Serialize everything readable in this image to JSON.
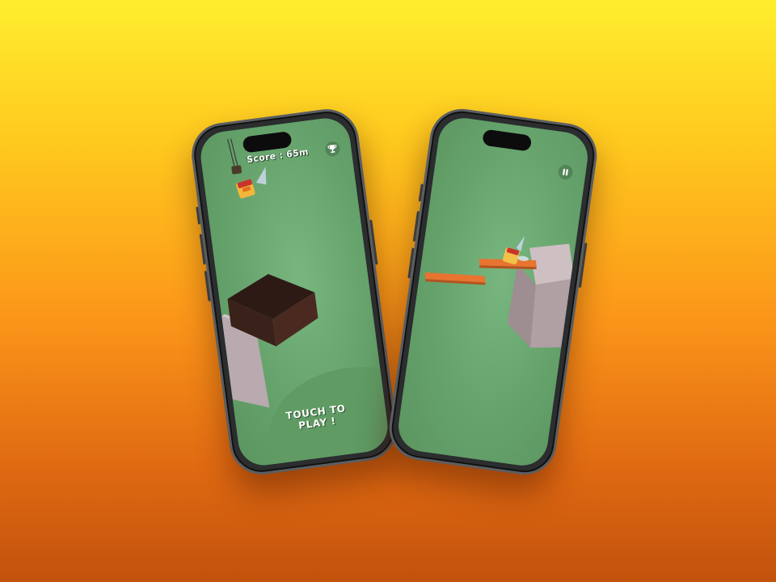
{
  "game": {
    "score_label": "Score : 65m",
    "start_prompt_line1": "TOUCH TO",
    "start_prompt_line2": "PLAY !"
  },
  "icons": {
    "leaderboard": "trophy-icon",
    "pause": "pause-icon",
    "player": "winged-cube-character"
  },
  "colors": {
    "background_top": "#ffee2e",
    "background_bottom": "#c2520c",
    "ground": "#6aa86f",
    "dark_block": "#3b2019",
    "stone_pillar": "#b3a5a8",
    "wood_plank": "#e86d2e",
    "player_body": "#f3b63a"
  }
}
